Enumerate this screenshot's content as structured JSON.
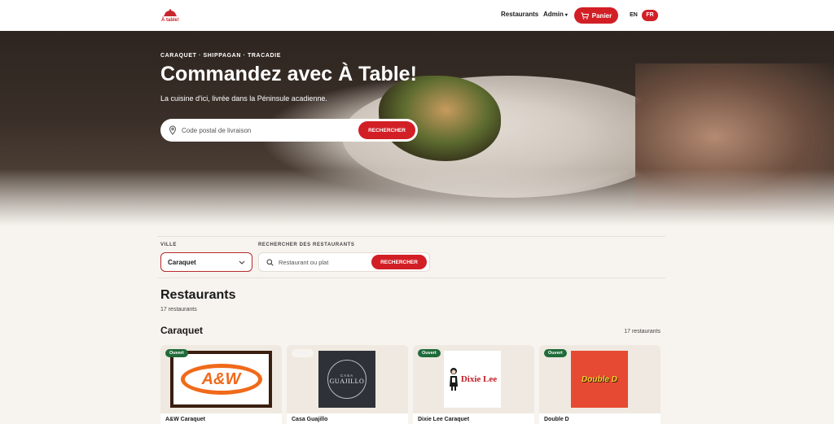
{
  "nav": {
    "logo_text": "À table!",
    "restaurants": "Restaurants",
    "admin": "Admin",
    "cart": "Panier",
    "lang_en": "EN",
    "lang_fr": "FR"
  },
  "hero": {
    "tagline": "CARAQUET · SHIPPAGAN · TRACADIE",
    "title": "Commandez avec À Table!",
    "subtitle": "La cuisine d'ici, livrée dans la Péninsule acadienne.",
    "search_placeholder": "Code postal de livraison",
    "search_button": "RECHERCHER"
  },
  "filters": {
    "city_label": "VILLE",
    "city_value": "Caraquet",
    "search_label": "RECHERCHER DES RESTAURANTS",
    "search_placeholder": "Restaurant ou plat",
    "search_button": "RECHERCHER"
  },
  "restaurants": {
    "title": "Restaurants",
    "count": "17 restaurants",
    "city_title": "Caraquet",
    "city_count": "17 restaurants",
    "cards": [
      {
        "name": "A&W Caraquet",
        "status": "Ouvert",
        "logo_text": "A&W"
      },
      {
        "name": "Casa Guajillo",
        "status": "Fermé",
        "logo_small": "CASA",
        "logo_text": "GUAJILLO"
      },
      {
        "name": "Dixie Lee Caraquet",
        "status": "Ouvert",
        "logo_text": "Dixie Lee"
      },
      {
        "name": "Double D",
        "status": "Ouvert",
        "logo_text": "Double D"
      }
    ]
  },
  "colors": {
    "accent": "#d21f26",
    "open_badge": "#1f6b3a",
    "page_bg": "#f7f4ef"
  }
}
